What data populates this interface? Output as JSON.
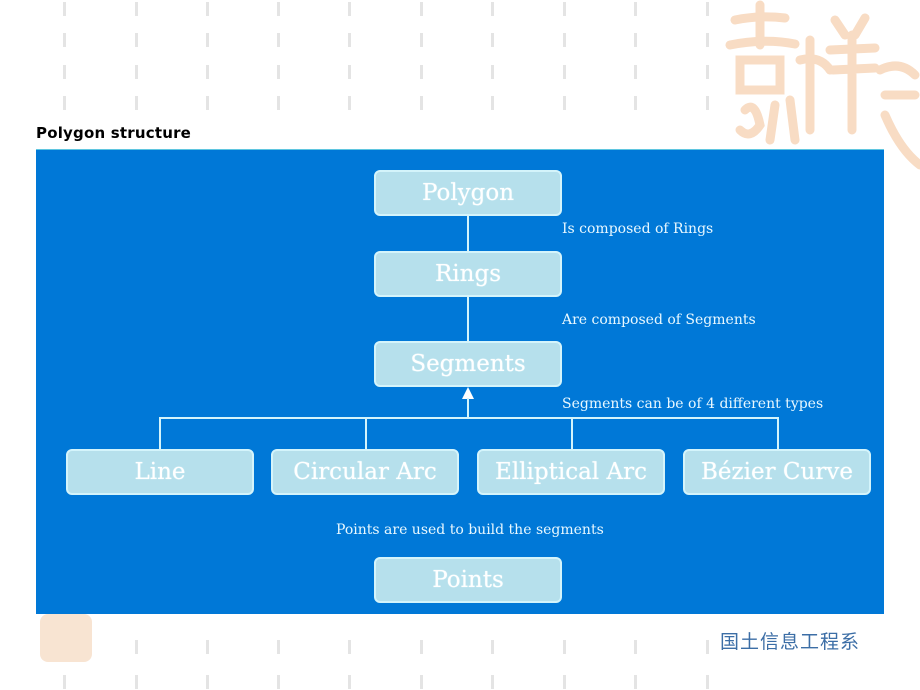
{
  "slide": {
    "title": "Polygon structure",
    "footer": "国土信息工程系"
  },
  "diagram": {
    "nodes": {
      "polygon": "Polygon",
      "rings": "Rings",
      "segments": "Segments",
      "line": "Line",
      "circular_arc": "Circular Arc",
      "elliptical_arc": "Elliptical Arc",
      "bezier_curve": "Bézier Curve",
      "points": "Points"
    },
    "relations": {
      "polygon_rings": "Is composed of Rings",
      "rings_segments": "Are composed of Segments",
      "segment_types": "Segments can be of 4 different types",
      "points_segments": "Points are used to build the segments"
    },
    "colors": {
      "panel": "#0078d7",
      "node_fill": "#b6e0ec",
      "node_border": "#d4f4fb",
      "watermark": "#f8e4d2",
      "footer_text": "#3c6ea6"
    }
  },
  "decoration": {
    "watermark_icon": "auspicious-calligraphy-seal"
  }
}
